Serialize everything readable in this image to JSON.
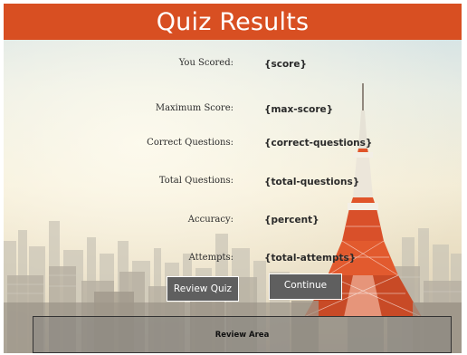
{
  "header": {
    "title": "Quiz Results"
  },
  "results": [
    {
      "label": "You Scored:",
      "value": "{score}"
    },
    {
      "label": "Maximum Score:",
      "value": "{max-score}"
    },
    {
      "label": "Correct Questions:",
      "value": "{correct-questions}"
    },
    {
      "label": "Total Questions:",
      "value": "{total-questions}"
    },
    {
      "label": "Accuracy:",
      "value": "{percent}"
    },
    {
      "label": "Attempts:",
      "value": "{total-attempts}"
    }
  ],
  "buttons": {
    "review": "Review Quiz",
    "continue": "Continue"
  },
  "review_area": {
    "label": "Review Area"
  },
  "colors": {
    "header": "#d84f22",
    "button": "#5f5f5f",
    "tower": "#e0542a"
  }
}
